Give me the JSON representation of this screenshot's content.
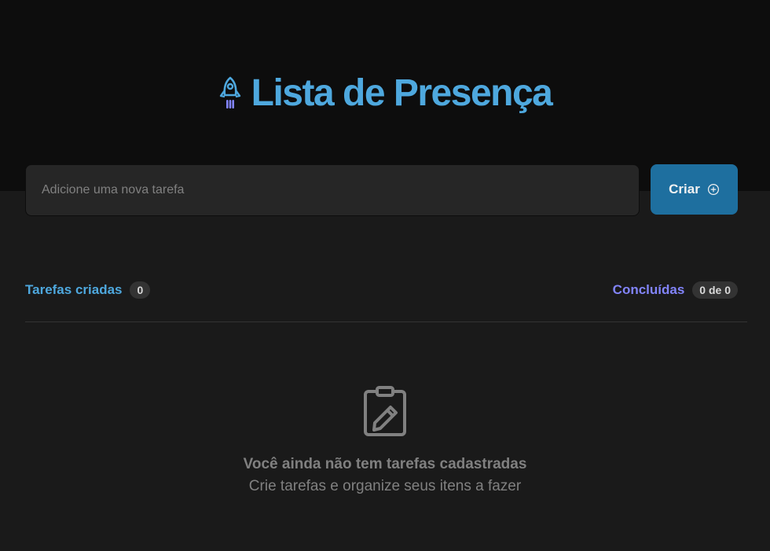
{
  "header": {
    "logo_icon": "rocket-icon",
    "title": "Lista de Presença",
    "colors": {
      "title": "#4ea8de",
      "rocket_flame": "#8284fa"
    }
  },
  "new_task": {
    "placeholder": "Adicione uma nova tarefa",
    "value": "",
    "button_label": "Criar",
    "button_icon": "plus-circle-icon",
    "button_color": "#1e6f9f"
  },
  "summary": {
    "created_label": "Tarefas criadas",
    "created_count": "0",
    "done_label": "Concluídas",
    "done_count": "0 de 0",
    "colors": {
      "created": "#4ea8de",
      "done": "#8284fa"
    }
  },
  "empty_state": {
    "icon": "clipboard-icon",
    "title": "Você ainda não tem tarefas cadastradas",
    "subtitle": "Crie tarefas e organize seus itens a fazer"
  }
}
